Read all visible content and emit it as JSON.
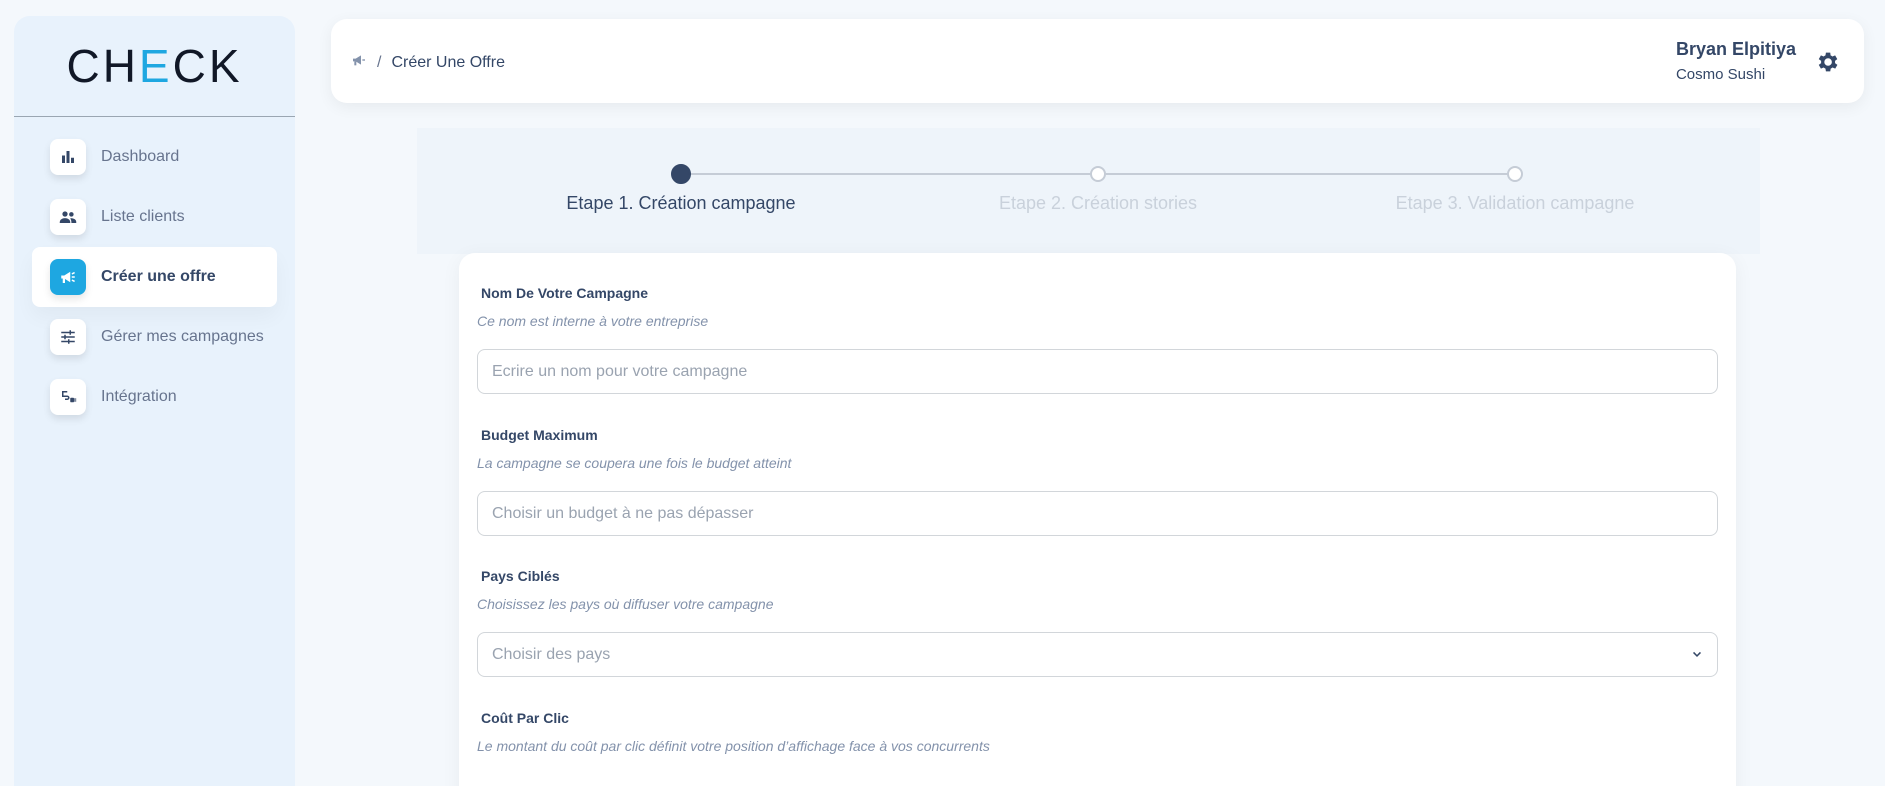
{
  "logo": {
    "left": "CH",
    "accent": "E",
    "right": "CK"
  },
  "sidebar": {
    "items": [
      {
        "label": "Dashboard",
        "icon": "bar-chart-icon"
      },
      {
        "label": "Liste clients",
        "icon": "users-icon"
      },
      {
        "label": "Créer une offre",
        "icon": "megaphone-icon",
        "active": true
      },
      {
        "label": "Gérer mes campagnes",
        "icon": "sliders-icon"
      },
      {
        "label": "Intégration",
        "icon": "plug-icon"
      }
    ]
  },
  "header": {
    "breadcrumb_separator": "/",
    "breadcrumb_current": "Créer Une Offre",
    "user_name": "Bryan Elpitiya",
    "user_company": "Cosmo Sushi"
  },
  "stepper": {
    "steps": [
      {
        "label": "Etape 1. Création campagne",
        "active": true
      },
      {
        "label": "Etape 2. Création stories",
        "active": false
      },
      {
        "label": "Etape 3. Validation campagne",
        "active": false
      }
    ]
  },
  "form": {
    "campaign_name": {
      "label": "Nom De Votre Campagne",
      "help": "Ce nom est interne à votre entreprise",
      "placeholder": "Ecrire un nom pour votre campagne",
      "value": ""
    },
    "budget": {
      "label": "Budget Maximum",
      "help": "La campagne se coupera une fois le budget atteint",
      "placeholder": "Choisir un budget à ne pas dépasser",
      "value": ""
    },
    "countries": {
      "label": "Pays Ciblés",
      "help": "Choisissez les pays où diffuser votre campagne",
      "placeholder": "Choisir des pays"
    },
    "cpc": {
      "label": "Coût Par Clic",
      "help": "Le montant du coût par clic définit votre position d’affichage face à vos concurrents"
    }
  },
  "colors": {
    "accent": "#1ea7e1",
    "text": "#344767",
    "muted": "#8392ab"
  }
}
